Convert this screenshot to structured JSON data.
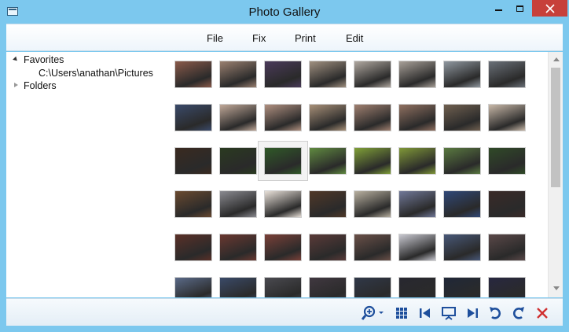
{
  "window": {
    "title": "Photo Gallery"
  },
  "menu": {
    "items": [
      "File",
      "Fix",
      "Print",
      "Edit"
    ]
  },
  "tree": {
    "favorites_label": "Favorites",
    "favorite_path": "C:\\Users\\anathan\\Pictures",
    "folders_label": "Folders"
  },
  "gallery": {
    "rows": 6,
    "columns": 8,
    "selected_index": 18,
    "photo_colors": [
      [
        "#8a5a4a",
        "#9a8070",
        "#4a3a5a",
        "#a09080",
        "#b0a8a0",
        "#a8a098",
        "#9098a0",
        "#6a7078"
      ],
      [
        "#3a4a6a",
        "#c0a898",
        "#b09080",
        "#a89078",
        "#a08070",
        "#907060",
        "#706050",
        "#c8b8a8"
      ],
      [
        "#3a2a20",
        "#2a3a20",
        "#305a28",
        "#608a40",
        "#80a038",
        "#809838",
        "#5a7a40",
        "#304a28"
      ],
      [
        "#6a4a30",
        "#8a8a90",
        "#e8e0d8",
        "#503828",
        "#b8b0a0",
        "#707898",
        "#304878",
        "#3a2a28"
      ],
      [
        "#5a3028",
        "#6a3830",
        "#7a4038",
        "#5a3a38",
        "#6a5048",
        "#c8c8d0",
        "#485878",
        "#5a4848"
      ],
      [
        "#5a6a88",
        "#3a4a68",
        "#4a4a50",
        "#403840",
        "#303848",
        "#282830",
        "#202838",
        "#282840"
      ]
    ]
  },
  "toolbar": {
    "tools": [
      "zoom-icon",
      "grid-view-icon",
      "previous-icon",
      "slideshow-icon",
      "next-icon",
      "rotate-left-icon",
      "rotate-right-icon",
      "delete-icon"
    ]
  },
  "colors": {
    "frame": "#7cc8ee",
    "close_button": "#c7403a",
    "toolbar_icon": "#1e4f9c",
    "delete_icon": "#d03030"
  }
}
